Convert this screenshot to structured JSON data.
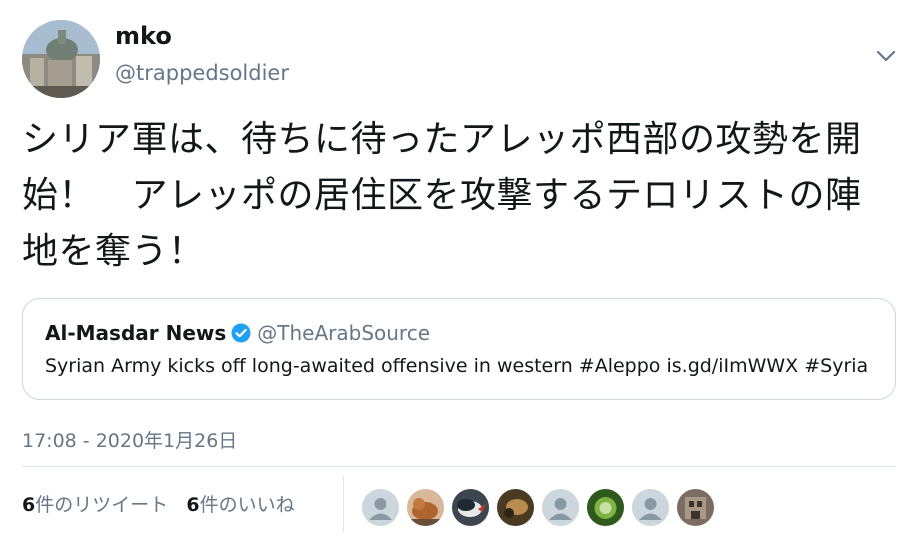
{
  "author": {
    "name": "mko",
    "handle": "@trappedsoldier",
    "avatar_icon": "cathedral-photo-avatar"
  },
  "tweet": {
    "text": "シリア軍は、待ちに待ったアレッポ西部の攻勢を開始！　アレッポの居住区を攻撃するテロリストの陣地を奪う！",
    "timestamp": "17:08 - 2020年1月26日"
  },
  "quoted": {
    "name": "Al-Masdar News",
    "handle": "@TheArabSource",
    "text": "Syrian Army kicks off long-awaited offensive in western #Aleppo is.gd/iImWWX #Syria"
  },
  "stats": {
    "retweets_count": "6",
    "retweets_label": "件のリツイート",
    "likes_count": "6",
    "likes_label": "件のいいね"
  },
  "likers": [
    {
      "icon": "default-user-avatar"
    },
    {
      "icon": "cat-photo-avatar"
    },
    {
      "icon": "bird-photo-avatar"
    },
    {
      "icon": "animal-photo-avatar"
    },
    {
      "icon": "default-user-avatar"
    },
    {
      "icon": "cabbage-photo-avatar"
    },
    {
      "icon": "default-user-avatar"
    },
    {
      "icon": "building-photo-avatar"
    }
  ],
  "colors": {
    "text": "#14171a",
    "secondary": "#657786",
    "border": "#ccd6dd",
    "verified": "#1da1f2"
  }
}
